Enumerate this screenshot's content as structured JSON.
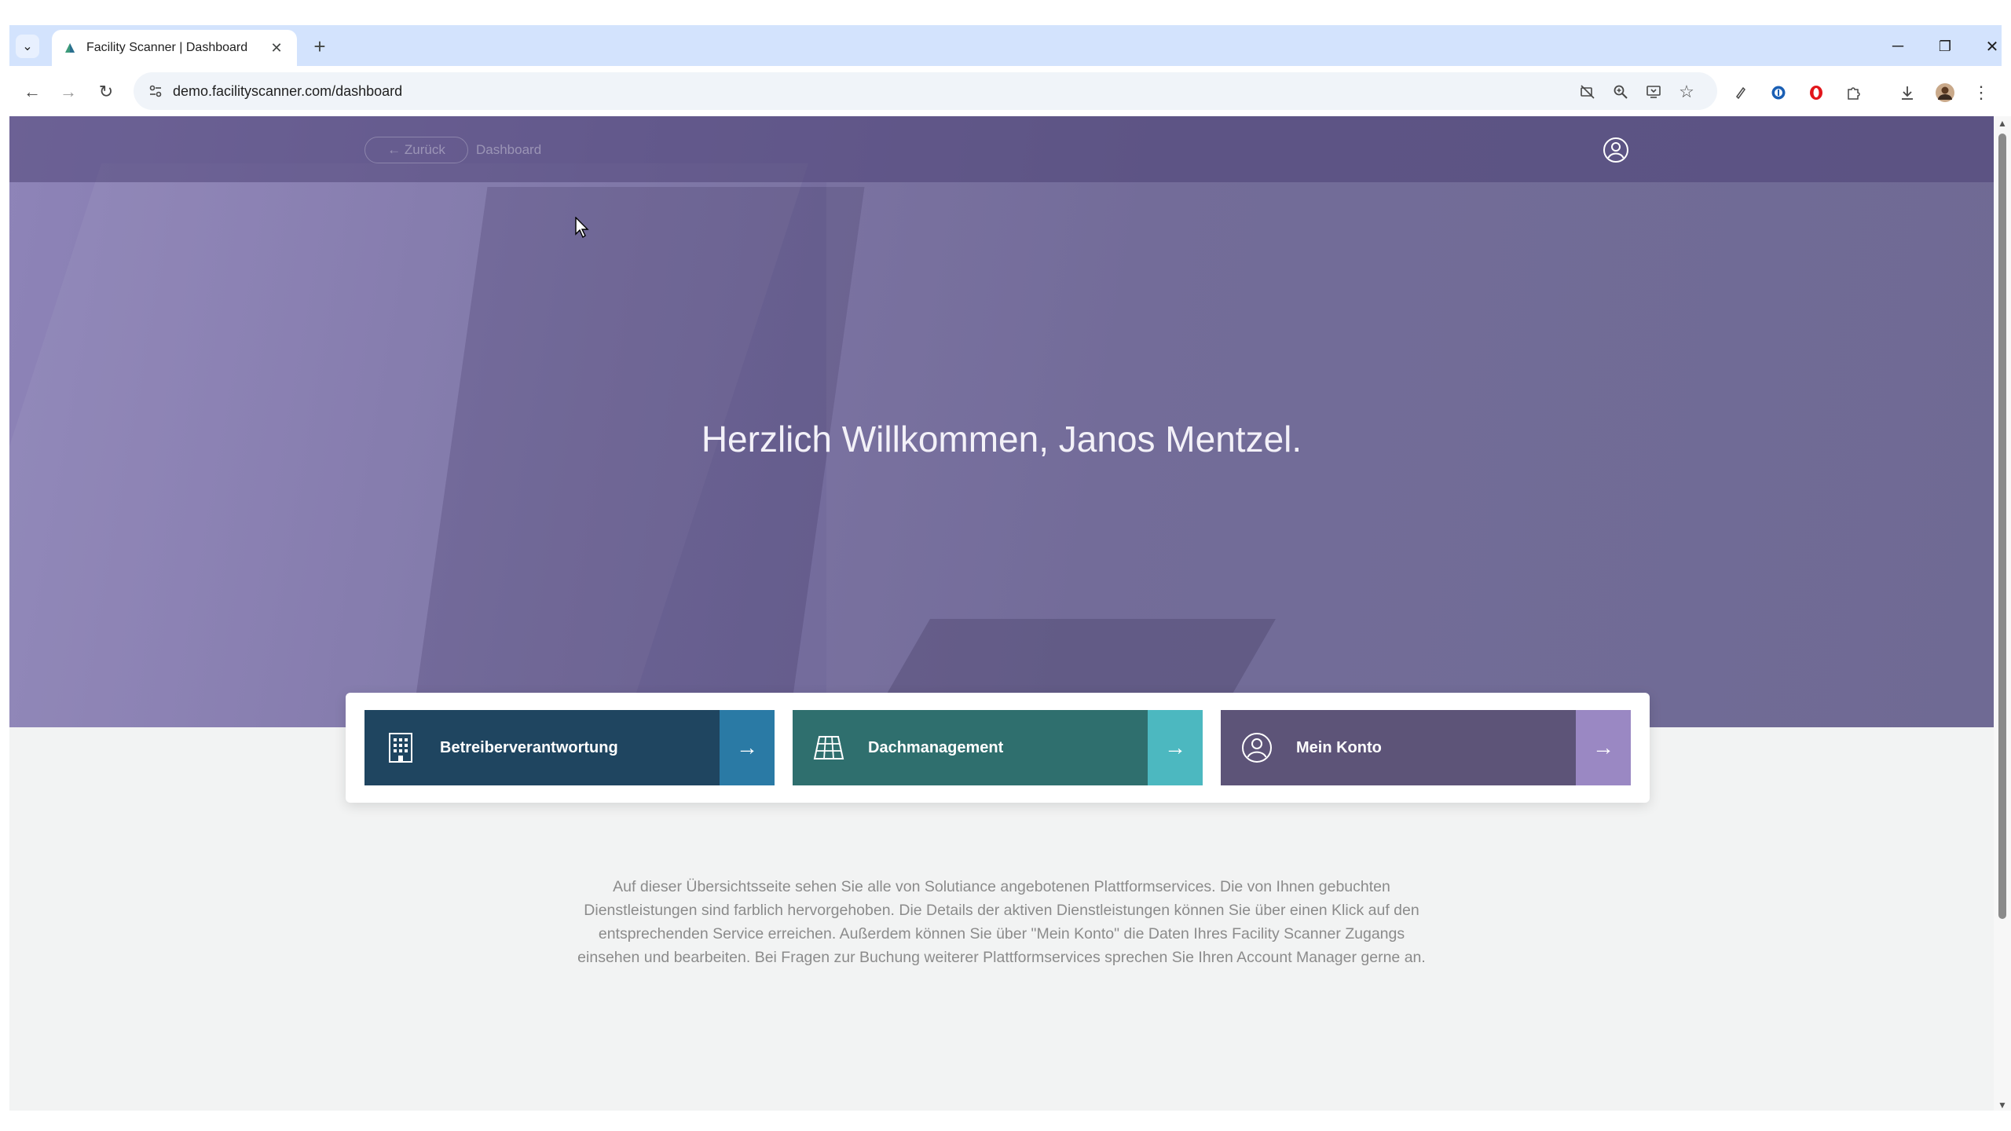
{
  "browser": {
    "tab_title": "Facility Scanner | Dashboard",
    "url": "demo.facilityscanner.com/dashboard",
    "new_tab_label": "+",
    "close_tab_label": "✕",
    "window_controls": {
      "minimize": "─",
      "restore": "❐",
      "close": "✕"
    },
    "icons": [
      "tab-list-icon",
      "back-icon",
      "forward-icon",
      "reload-icon",
      "site-info-icon",
      "camera-off-icon",
      "zoom-icon",
      "install-app-icon",
      "bookmark-star-icon",
      "extension-icon",
      "password-manager-icon",
      "opera-icon",
      "puzzle-icon",
      "download-icon",
      "profile-avatar",
      "menu-icon"
    ]
  },
  "page": {
    "nav": {
      "back_label": "← Zurück",
      "breadcrumb": "Dashboard"
    },
    "welcome": "Herzlich Willkommen, Janos Mentzel.",
    "cards": [
      {
        "label": "Betreiberverantwortung",
        "icon": "building-icon",
        "color": "#1f4560",
        "accent": "#2a7aa5"
      },
      {
        "label": "Dachmanagement",
        "icon": "solar-panel-icon",
        "color": "#2f6f6e",
        "accent": "#4cb8c0"
      },
      {
        "label": "Mein Konto",
        "icon": "user-circle-icon",
        "color": "#5d5478",
        "accent": "#9a88c3"
      }
    ],
    "intro_text": "Auf dieser Übersichtsseite sehen Sie alle von Solutiance angebotenen Plattformservices. Die von Ihnen gebuchten Dienstleistungen sind farblich hervorgehoben. Die Details der aktiven Dienstleistungen können Sie über einen Klick auf den entsprechenden Service erreichen. Außerdem können Sie über \"Mein Konto\" die Daten Ihres Facility Scanner Zugangs einsehen und bearbeiten. Bei Fragen zur Buchung weiterer Plattformservices sprechen Sie Ihren Account Manager gerne an."
  }
}
